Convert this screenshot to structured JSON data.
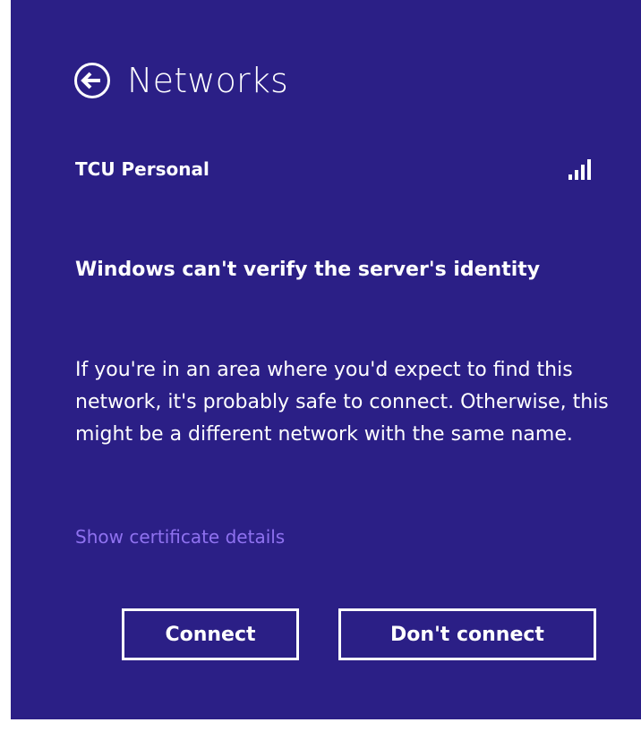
{
  "header": {
    "title": "Networks"
  },
  "network": {
    "name": "TCU Personal",
    "signal_bars": 4,
    "signal_icon": "wifi-signal-full-icon"
  },
  "warning": {
    "heading": "Windows can't verify the server's identity",
    "message": "If you're in an area where you'd expect to find this network, it's probably safe to connect. Otherwise, this might be a different network with the same name."
  },
  "link": {
    "label": "Show certificate details"
  },
  "buttons": {
    "connect_label": "Connect",
    "dont_connect_label": "Don't connect"
  },
  "colors": {
    "background": "#2b1f86",
    "text": "#ffffff",
    "link": "#8f72f0"
  }
}
